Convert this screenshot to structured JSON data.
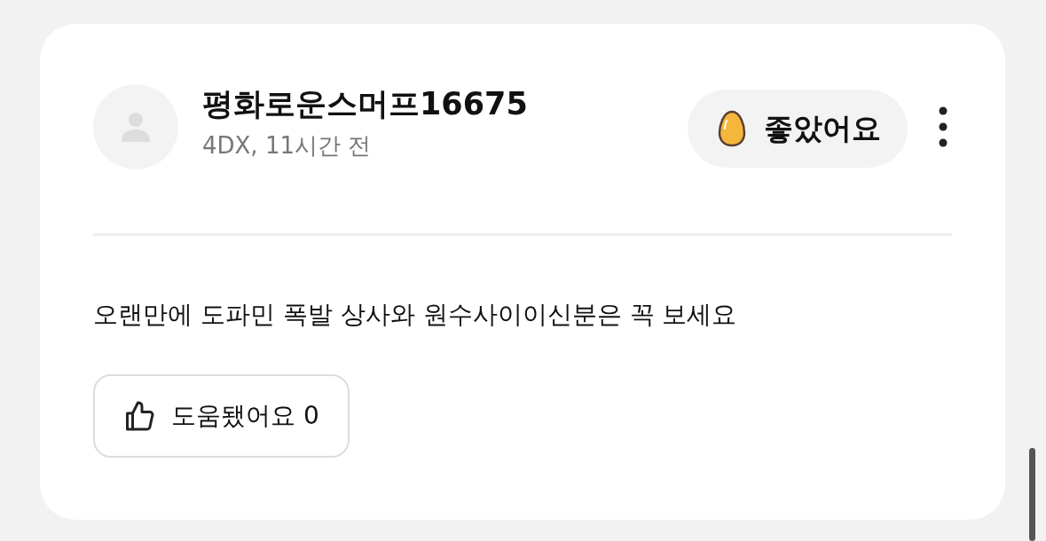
{
  "review": {
    "author": "평화로운스머프16675",
    "meta": "4DX, 11시간 전",
    "reaction": {
      "label": "좋았어요"
    },
    "body": "오랜만에 도파민 폭발 상사와 원수사이이신분은 꼭 보세요",
    "helpful": {
      "label": "도움됐어요 0"
    }
  }
}
